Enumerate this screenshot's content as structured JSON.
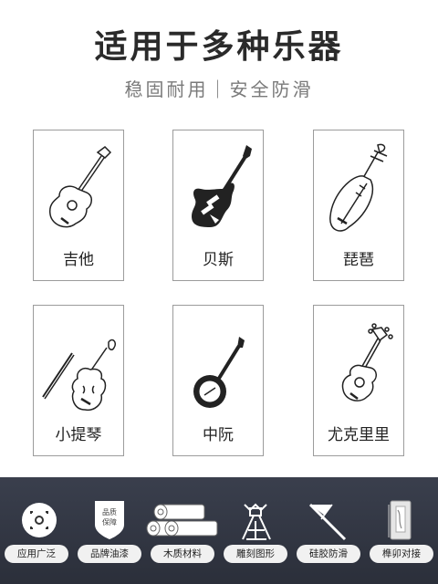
{
  "header": {
    "title": "适用于多种乐器",
    "subtitle": "稳固耐用｜安全防滑"
  },
  "instruments": [
    {
      "label": "吉他",
      "icon": "acoustic-guitar-icon"
    },
    {
      "label": "贝斯",
      "icon": "electric-bass-icon"
    },
    {
      "label": "琵琶",
      "icon": "pipa-icon"
    },
    {
      "label": "小提琴",
      "icon": "violin-icon"
    },
    {
      "label": "中阮",
      "icon": "banjo-icon"
    },
    {
      "label": "尤克里里",
      "icon": "ukulele-icon"
    }
  ],
  "features": [
    {
      "label": "应用广泛",
      "icon": "target-icon"
    },
    {
      "label": "品牌油漆",
      "icon": "quality-badge-icon",
      "badge_text": [
        "品质",
        "保障"
      ]
    },
    {
      "label": "木质材料",
      "icon": "wood-logs-icon"
    },
    {
      "label": "雕刻图形",
      "icon": "carving-icon"
    },
    {
      "label": "硅胶防滑",
      "icon": "silicone-icon"
    },
    {
      "label": "榫卯对接",
      "icon": "joint-icon"
    }
  ],
  "colors": {
    "footer_bg": "#30343f",
    "pill_bg": "#f1f1f1",
    "card_border": "#9c9c9c"
  }
}
